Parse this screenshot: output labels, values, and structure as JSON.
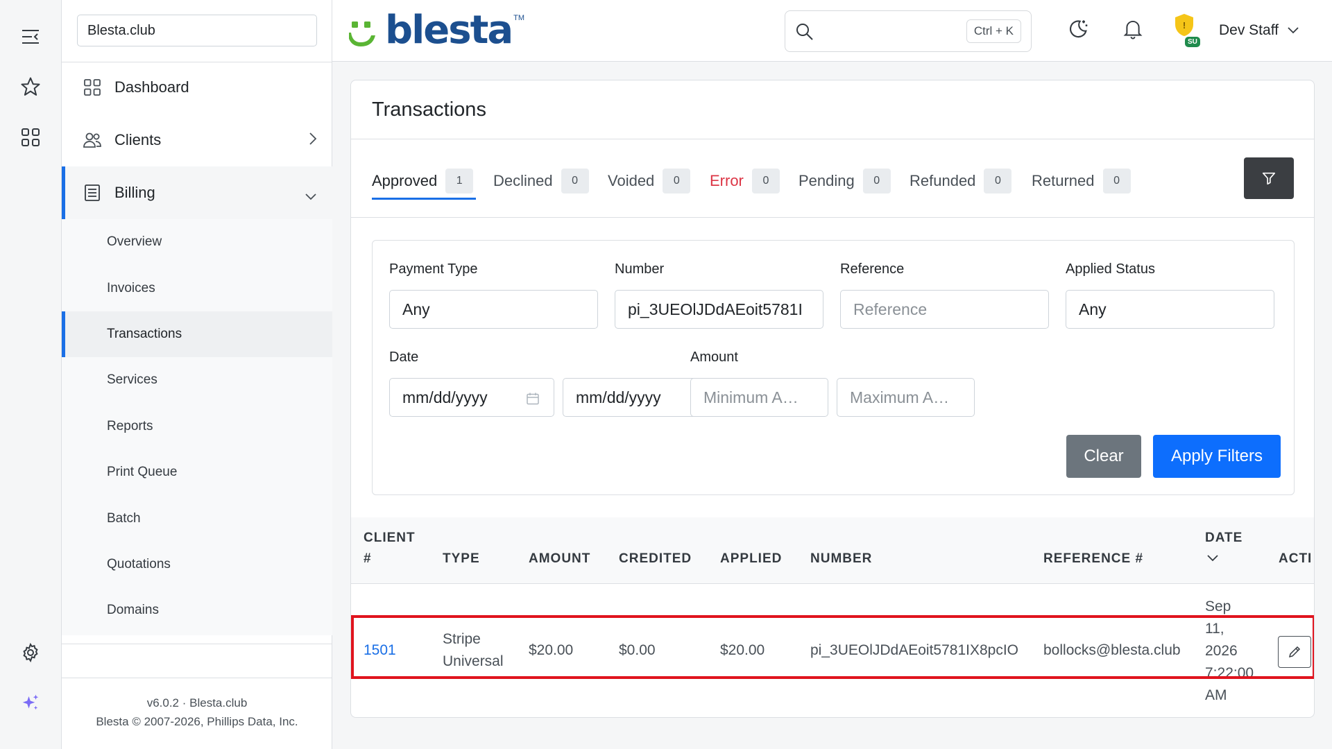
{
  "sidebar": {
    "site_name": "Blesta.club",
    "nav": {
      "dashboard": "Dashboard",
      "clients": "Clients",
      "billing": "Billing"
    },
    "billing_items": {
      "overview": "Overview",
      "invoices": "Invoices",
      "transactions": "Transactions",
      "services": "Services",
      "reports": "Reports",
      "print_queue": "Print Queue",
      "batch": "Batch",
      "quotations": "Quotations",
      "domains": "Domains"
    },
    "footer_version": "v6.0.2 · Blesta.club",
    "footer_copyright": "Blesta © 2007-2026, Phillips Data, Inc."
  },
  "header": {
    "logo_text": "blesta",
    "logo_tm": "TM",
    "search_shortcut": "Ctrl + K",
    "badge_label": "SU",
    "user_name": "Dev Staff"
  },
  "page": {
    "title": "Transactions",
    "tabs": [
      {
        "label": "Approved",
        "count": "1"
      },
      {
        "label": "Declined",
        "count": "0"
      },
      {
        "label": "Voided",
        "count": "0"
      },
      {
        "label": "Error",
        "count": "0"
      },
      {
        "label": "Pending",
        "count": "0"
      },
      {
        "label": "Refunded",
        "count": "0"
      },
      {
        "label": "Returned",
        "count": "0"
      }
    ],
    "filters": {
      "payment_type_label": "Payment Type",
      "payment_type_value": "Any",
      "number_label": "Number",
      "number_value": "pi_3UEOlJDdAEoit5781I",
      "reference_label": "Reference",
      "reference_placeholder": "Reference",
      "applied_status_label": "Applied Status",
      "applied_status_value": "Any",
      "date_label": "Date",
      "date_from_placeholder": "mm/dd/yyyy",
      "date_to_placeholder": "mm/dd/yyyy",
      "amount_label": "Amount",
      "amount_min_placeholder": "Minimum A…",
      "amount_max_placeholder": "Maximum A…",
      "clear_label": "Clear",
      "apply_label": "Apply Filters"
    },
    "table": {
      "headers": {
        "client_line1": "CLIENT",
        "client_line2": "#",
        "type": "TYPE",
        "amount": "AMOUNT",
        "credited": "CREDITED",
        "applied": "APPLIED",
        "number": "NUMBER",
        "reference": "REFERENCE #",
        "date": "DATE",
        "actions": "ACTI"
      },
      "rows": [
        {
          "client": "1501",
          "type_line1": "Stripe",
          "type_line2": "Universal",
          "amount": "$20.00",
          "credited": "$0.00",
          "applied": "$20.00",
          "number": "pi_3UEOlJDdAEoit5781IX8pcIO",
          "reference": "bollocks@blesta.club",
          "date_line1": "Sep",
          "date_line2": "11,",
          "date_line3": "2026",
          "date_line4": "7:22:00",
          "date_line5": "AM"
        }
      ]
    }
  },
  "colors": {
    "accent": "#1a6fe6",
    "error": "#dc3545",
    "highlight": "#e0141e",
    "brand_blue": "#1c4f8f",
    "brand_green": "#5ab534"
  },
  "icons": {
    "rail": [
      "menu-collapse-icon",
      "star-icon",
      "apps-grid-icon",
      "settings-gear-icon",
      "sparkles-icon"
    ],
    "header": [
      "search-icon",
      "moon-icon",
      "bell-icon",
      "shield-icon",
      "chevron-down-icon"
    ]
  }
}
